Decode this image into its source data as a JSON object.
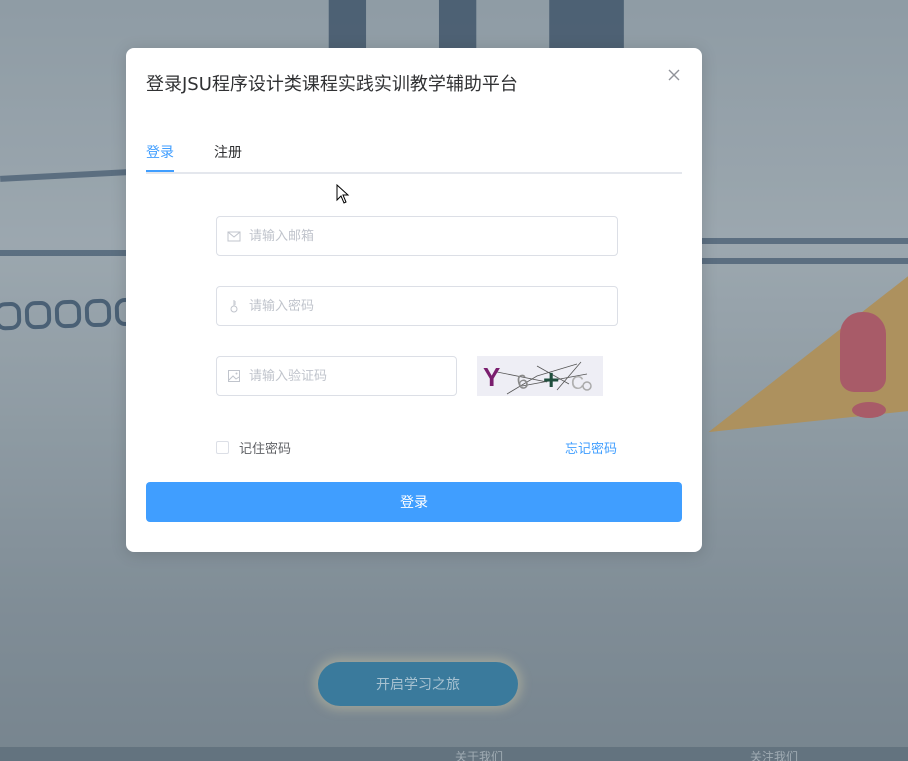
{
  "background": {
    "start_button": "开启学习之旅",
    "footer_links": [
      "关于我们",
      "关注我们"
    ]
  },
  "dialog": {
    "title": "登录JSU程序设计类课程实践实训教学辅助平台",
    "close_icon": "close-icon",
    "tabs": [
      {
        "label": "登录",
        "active": true
      },
      {
        "label": "注册",
        "active": false
      }
    ],
    "email": {
      "placeholder": "请输入邮箱",
      "value": "",
      "icon": "mail-icon"
    },
    "password": {
      "placeholder": "请输入密码",
      "value": "",
      "icon": "key-icon"
    },
    "captcha": {
      "placeholder": "请输入验证码",
      "value": "",
      "icon": "image-icon",
      "image_text": "Y6+C"
    },
    "remember_label": "记住密码",
    "remember_checked": false,
    "forgot_label": "忘记密码",
    "submit_label": "登录"
  },
  "colors": {
    "primary": "#409eff",
    "text": "#303133",
    "placeholder": "#c0c4cc",
    "border": "#dcdfe6"
  }
}
